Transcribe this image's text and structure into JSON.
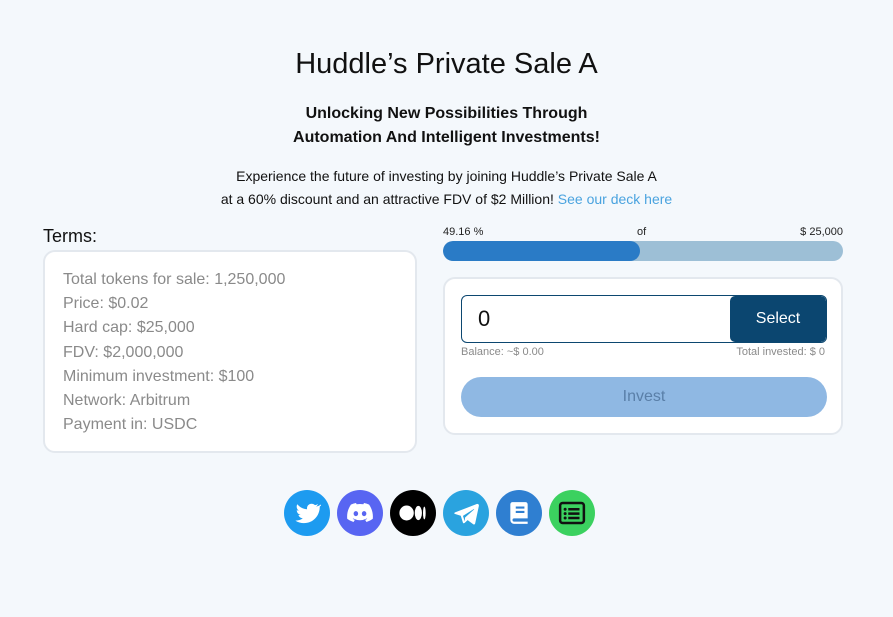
{
  "header": {
    "title": "Huddle’s Private Sale A",
    "subtitle_line1": "Unlocking New Possibilities Through",
    "subtitle_line2": "Automation And Intelligent Investments!",
    "intro_line1": "Experience the future of investing by joining Huddle’s Private Sale A",
    "intro_line2": "at a 60% discount and an attractive FDV of $2 Million!",
    "deck_link": "See our deck here"
  },
  "terms": {
    "label": "Terms:",
    "items": [
      "Total tokens for sale: 1,250,000",
      "Price: $0.02",
      "Hard cap: $25,000",
      "FDV: $2,000,000",
      "Minimum investment: $100",
      "Network: Arbitrum",
      "Payment in: USDC"
    ]
  },
  "progress": {
    "percent_label": "49.16 %",
    "of_label": "of",
    "cap_label": "$ 25,000",
    "fraction": 0.4916,
    "fill_color": "#2a7bc6",
    "track_color": "#9dbfd6"
  },
  "invest": {
    "amount_value": "0",
    "select_label": "Select",
    "balance_label": "Balance: ~$ 0.00",
    "total_invested_label": "Total invested: $ 0",
    "invest_label": "Invest"
  },
  "socials": [
    {
      "icon": "twitter-icon",
      "color": "#1d9bf0"
    },
    {
      "icon": "discord-icon",
      "color": "#5865f2"
    },
    {
      "icon": "medium-icon",
      "color": "#000000"
    },
    {
      "icon": "telegram-icon",
      "color": "#2aa3df"
    },
    {
      "icon": "docs-book-icon",
      "color": "#2f7fd1"
    },
    {
      "icon": "article-list-icon",
      "color": "#3bd15f"
    }
  ]
}
